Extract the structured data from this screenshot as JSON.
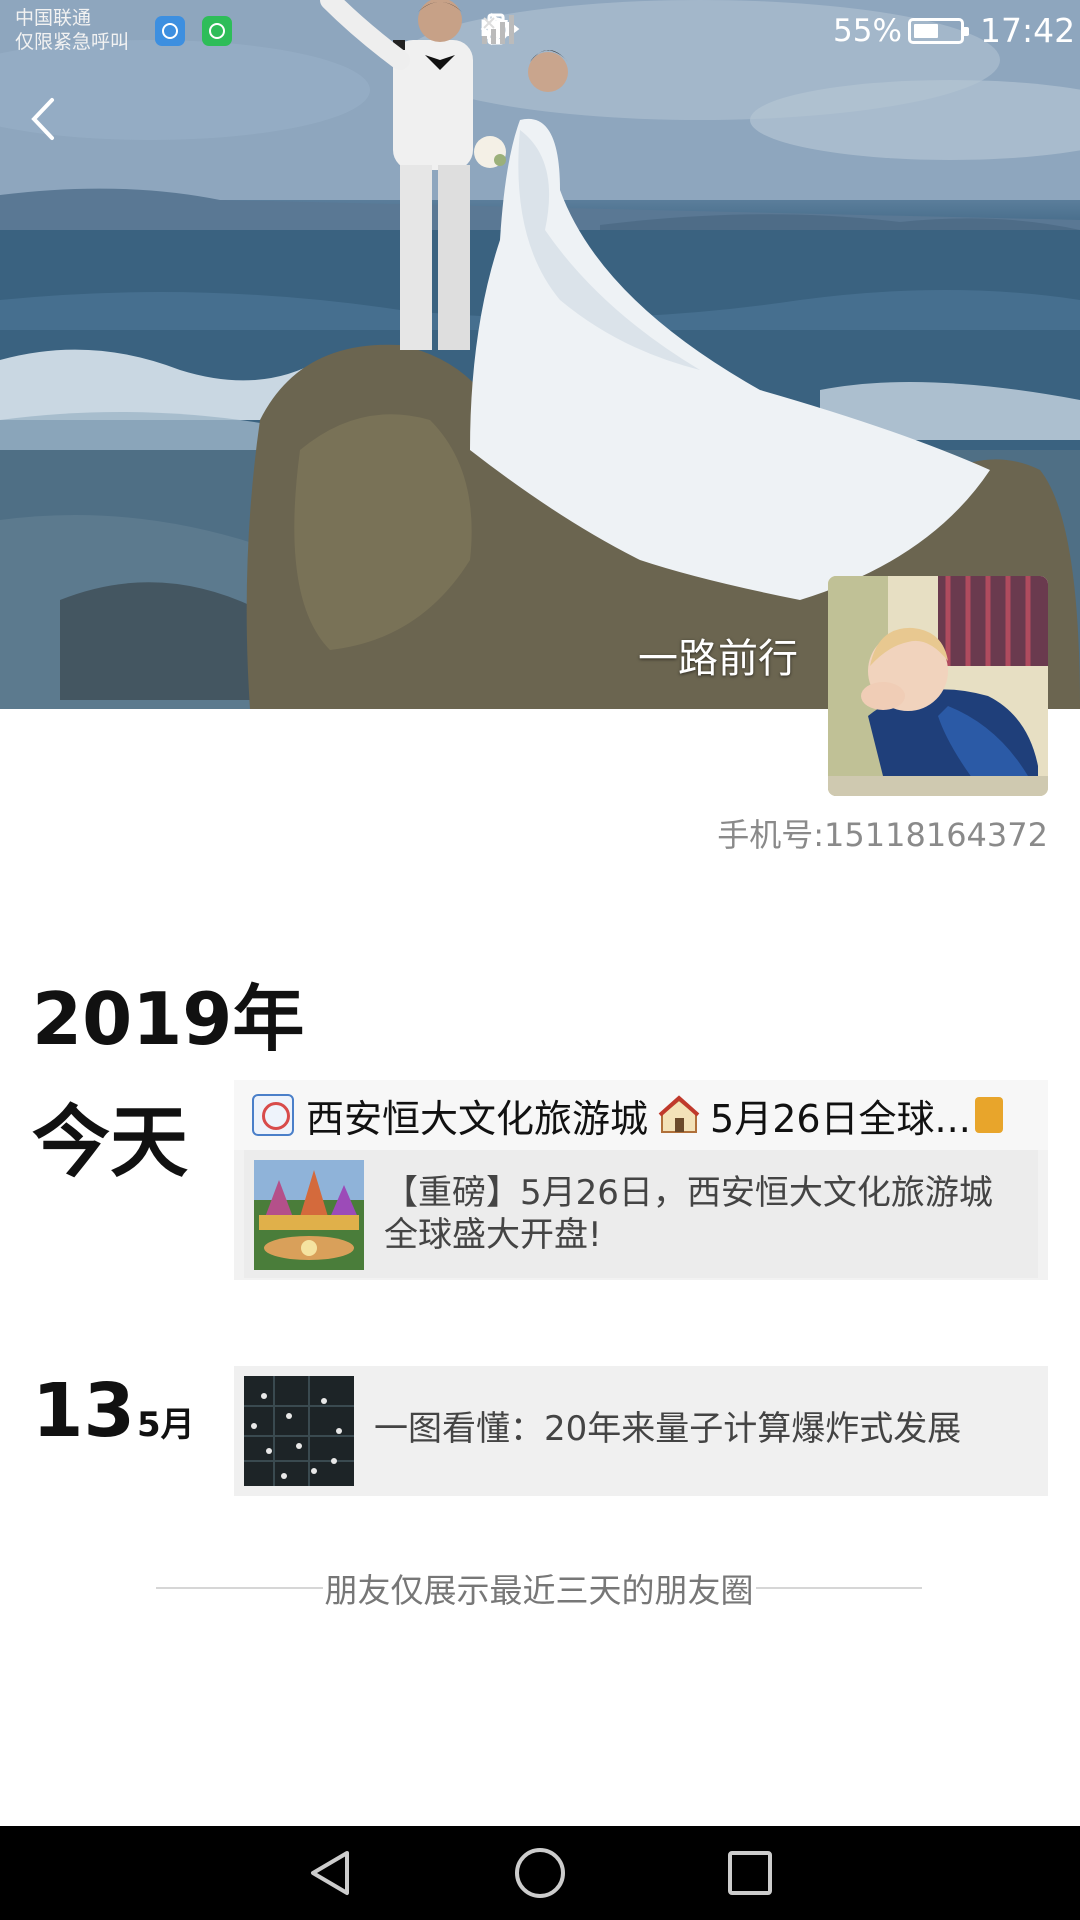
{
  "status_bar": {
    "carrier_line1": "中国联通",
    "carrier_line2": "仅限紧急呼叫",
    "battery_percent": "55%",
    "battery_level": 0.55,
    "time": "17:42"
  },
  "header": {
    "username": "一路前行",
    "phone": "手机号:15118164372"
  },
  "timeline": {
    "year": "2019年",
    "groups": [
      {
        "label": "今天",
        "header_text": "西安恒大文化旅游城",
        "header_text2": "5月26日全球...",
        "share_text": "【重磅】5月26日，西安恒大文化旅游城全球盛大开盘!"
      },
      {
        "day": "13",
        "month": "5月",
        "share_text": "一图看懂：20年来量子计算爆炸式发展"
      }
    ],
    "footer_note": "朋友仅展示最近三天的朋友圈"
  },
  "icons": [
    "back-arrow-icon",
    "bluetooth-icon",
    "vibrate-icon",
    "alarm-icon",
    "eye-icon",
    "signal-h-plus-icon",
    "signal-bars-icon",
    "no-signal-icon",
    "battery-icon",
    "nav-back-icon",
    "nav-home-icon",
    "nav-recent-icon"
  ]
}
